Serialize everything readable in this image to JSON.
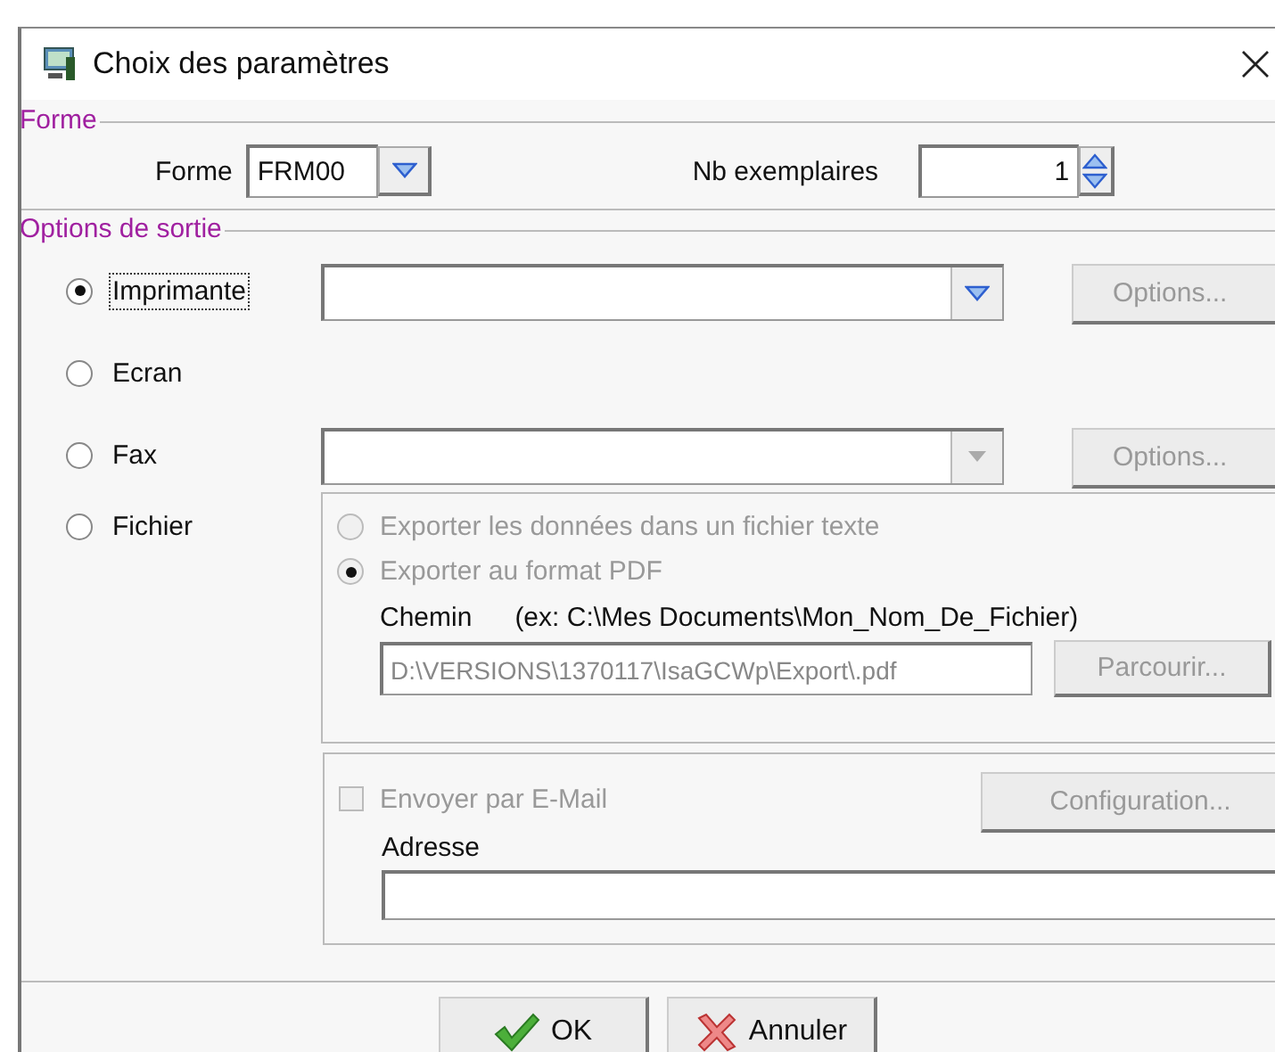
{
  "window": {
    "title": "Choix des paramètres"
  },
  "forme_group": {
    "legend": "Forme",
    "forme_label": "Forme",
    "forme_value": "FRM00",
    "copies_label": "Nb exemplaires",
    "copies_value": "1"
  },
  "output_group": {
    "legend": "Options de sortie",
    "outputs": [
      {
        "label": "Imprimante",
        "selected": true,
        "focused": true,
        "kind": "combo",
        "combo_disabled": false,
        "options_button": "Options...",
        "options_disabled": true
      },
      {
        "label": "Ecran",
        "selected": false,
        "focused": false,
        "kind": "plain"
      },
      {
        "label": "Fax",
        "selected": false,
        "focused": false,
        "kind": "combo",
        "combo_disabled": true,
        "options_button": "Options...",
        "options_disabled": true
      },
      {
        "label": "Fichier",
        "selected": false,
        "focused": false,
        "kind": "file"
      }
    ]
  },
  "file_panel": {
    "disabled": true,
    "formats": [
      {
        "label": "Exporter les données dans un fichier texte",
        "selected": false
      },
      {
        "label": "Exporter au format PDF",
        "selected": true
      }
    ],
    "path_label": "Chemin",
    "path_hint": "(ex: C:\\Mes Documents\\Mon_Nom_De_Fichier)",
    "path_value": "D:\\VERSIONS\\1370117\\IsaGCWp\\Export\\.pdf",
    "browse_button": "Parcourir..."
  },
  "email_panel": {
    "send_label": "Envoyer par E-Mail",
    "send_checked": false,
    "disabled": true,
    "config_button": "Configuration...",
    "address_label": "Adresse"
  },
  "buttons": [
    {
      "label": "OK",
      "kind": "ok"
    },
    {
      "label": "Annuler",
      "kind": "cancel"
    }
  ]
}
